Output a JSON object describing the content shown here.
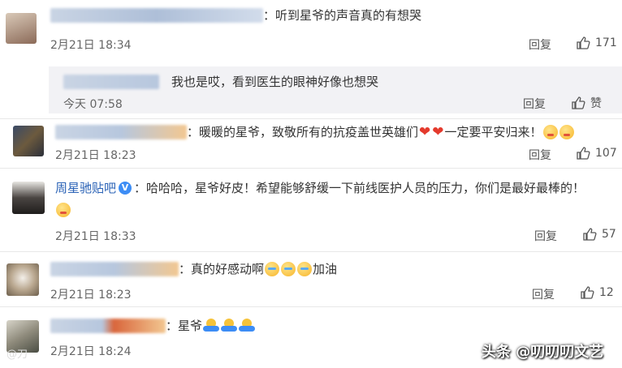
{
  "comments": [
    {
      "text": "：听到星爷的声音真的有想哭",
      "time": "2月21日 18:34",
      "reply_label": "回复",
      "like_count": "171",
      "subreply": {
        "text": "我也是哎，看到医生的眼神好像也想哭",
        "time": "今天 07:58",
        "reply_label": "回复",
        "like_label": "赞"
      }
    },
    {
      "text": "：暖暖的星爷，致敬所有的抗疫盖世英雄们",
      "text_after": "一定要平安归来！",
      "time": "2月21日 18:23",
      "reply_label": "回复",
      "like_count": "107"
    },
    {
      "name": "周星驰贴吧",
      "text": "：哈哈哈，星爷好皮！希望能够舒缓一下前线医护人员的压力，你们是最好最棒的！",
      "time": "2月21日 18:33",
      "reply_label": "回复",
      "like_count": "57"
    },
    {
      "text": "：真的好感动啊",
      "text_after": "加油",
      "time": "2月21日 18:23",
      "reply_label": "回复",
      "like_count": "12"
    },
    {
      "text": "：星爷",
      "time": "2月21日 18:24"
    }
  ],
  "watermark": "头条 @叨叨叨文艺",
  "watermark_left": "@刀",
  "colors": {
    "name": "#2a62b6",
    "verified": "#3d8df5",
    "heart": "#e43a2d"
  }
}
